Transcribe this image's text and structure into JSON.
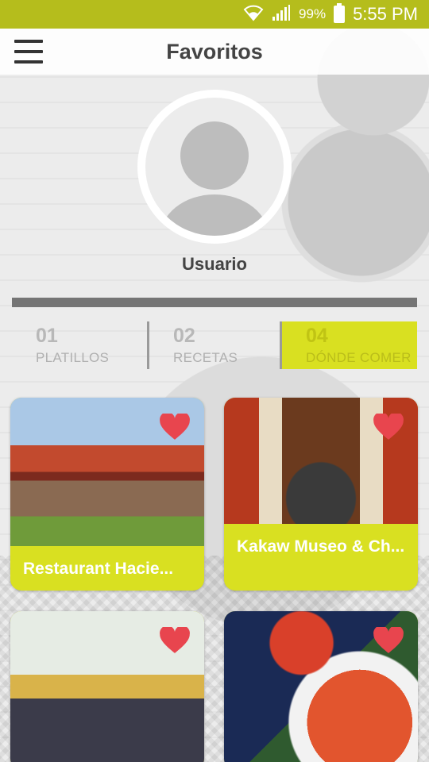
{
  "status_bar": {
    "battery": "99%",
    "time": "5:55 PM"
  },
  "header": {
    "title": "Favoritos"
  },
  "profile": {
    "name": "Usuario"
  },
  "tabs": [
    {
      "number": "01",
      "label": "PLATILLOS",
      "selected": false
    },
    {
      "number": "02",
      "label": "RECETAS",
      "selected": false
    },
    {
      "number": "04",
      "label": "DÓNDE COMER",
      "selected": true
    }
  ],
  "cards": [
    {
      "title": "Restaurant Hacie...",
      "favorite": true
    },
    {
      "title": "Kakaw Museo & Ch...",
      "favorite": true
    },
    {
      "title": "",
      "favorite": true
    },
    {
      "title": "",
      "favorite": true
    }
  ],
  "colors": {
    "accent": "#d9e021",
    "status_bar": "#b5bd1c",
    "heart": "#e8454e"
  }
}
